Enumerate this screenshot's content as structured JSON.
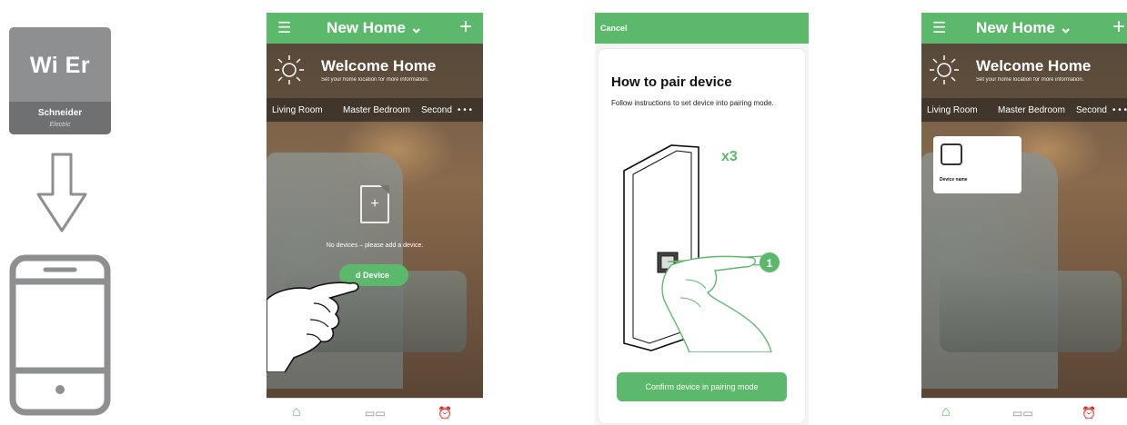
{
  "guide": {
    "logo_word": "Wi Er",
    "logo_brand": "Schneider",
    "logo_sub": "Electric"
  },
  "screens": [
    {
      "menu_icon": "hamburger-icon",
      "title": "New Home ⌄",
      "plus": "+",
      "welcome_title": "Welcome Home",
      "welcome_sub": "Set your home location for more information.",
      "rooms": [
        "Living Room",
        "Master Bedroom",
        "Second",
        "• • •"
      ],
      "empty_message": "No devices – please add a device.",
      "add_button": "d Device"
    },
    {
      "cancel": "Cancel",
      "pair_title": "How to pair device",
      "pair_instructions": "Follow instructions to set device into pairing mode.",
      "press_count": "x3",
      "step_number": "1",
      "confirm_button": "Confirm device in pairing mode"
    },
    {
      "title": "New Home ⌄",
      "plus": "+",
      "welcome_title": "Welcome Home",
      "welcome_sub": "Set your home location for more information.",
      "rooms": [
        "Living Room",
        "Master Bedroom",
        "Second",
        "• • •"
      ],
      "device_name": "Device name"
    }
  ],
  "nav_icons": [
    "home-icon",
    "grid-icon",
    "alarm-icon"
  ],
  "colors": {
    "accent": "#5cb86a",
    "logo_gray": "#8e8f91"
  }
}
